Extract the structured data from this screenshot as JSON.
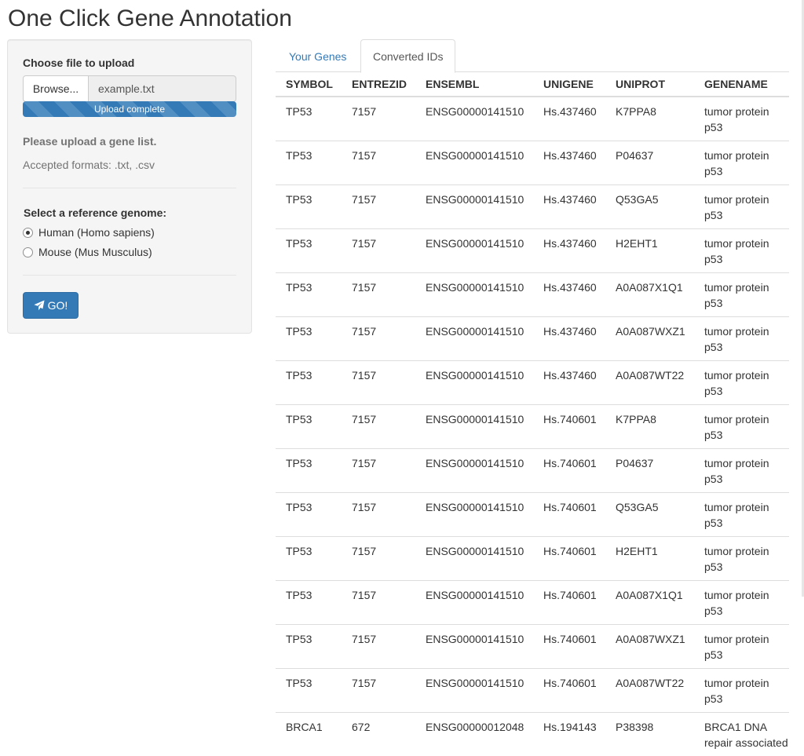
{
  "app": {
    "title": "One Click Gene Annotation"
  },
  "sidebar": {
    "upload_label": "Choose file to upload",
    "browse_label": "Browse...",
    "file_name": "example.txt",
    "progress_text": "Upload complete",
    "progress_value": 1.0,
    "help_title": "Please upload a gene list.",
    "help_formats": "Accepted formats: .txt, .csv",
    "genome_label": "Select a reference genome:",
    "genome_options": [
      {
        "label": "Human (Homo sapiens)",
        "checked": true
      },
      {
        "label": "Mouse (Mus Musculus)",
        "checked": false
      }
    ],
    "go_label": "GO!"
  },
  "tabs": [
    {
      "label": "Your Genes",
      "active": false
    },
    {
      "label": "Converted IDs",
      "active": true
    }
  ],
  "table": {
    "headers": [
      "SYMBOL",
      "ENTREZID",
      "ENSEMBL",
      "UNIGENE",
      "UNIPROT",
      "GENENAME"
    ],
    "rows": [
      [
        "TP53",
        "7157",
        "ENSG00000141510",
        "Hs.437460",
        "K7PPA8",
        "tumor protein p53"
      ],
      [
        "TP53",
        "7157",
        "ENSG00000141510",
        "Hs.437460",
        "P04637",
        "tumor protein p53"
      ],
      [
        "TP53",
        "7157",
        "ENSG00000141510",
        "Hs.437460",
        "Q53GA5",
        "tumor protein p53"
      ],
      [
        "TP53",
        "7157",
        "ENSG00000141510",
        "Hs.437460",
        "H2EHT1",
        "tumor protein p53"
      ],
      [
        "TP53",
        "7157",
        "ENSG00000141510",
        "Hs.437460",
        "A0A087X1Q1",
        "tumor protein p53"
      ],
      [
        "TP53",
        "7157",
        "ENSG00000141510",
        "Hs.437460",
        "A0A087WXZ1",
        "tumor protein p53"
      ],
      [
        "TP53",
        "7157",
        "ENSG00000141510",
        "Hs.437460",
        "A0A087WT22",
        "tumor protein p53"
      ],
      [
        "TP53",
        "7157",
        "ENSG00000141510",
        "Hs.740601",
        "K7PPA8",
        "tumor protein p53"
      ],
      [
        "TP53",
        "7157",
        "ENSG00000141510",
        "Hs.740601",
        "P04637",
        "tumor protein p53"
      ],
      [
        "TP53",
        "7157",
        "ENSG00000141510",
        "Hs.740601",
        "Q53GA5",
        "tumor protein p53"
      ],
      [
        "TP53",
        "7157",
        "ENSG00000141510",
        "Hs.740601",
        "H2EHT1",
        "tumor protein p53"
      ],
      [
        "TP53",
        "7157",
        "ENSG00000141510",
        "Hs.740601",
        "A0A087X1Q1",
        "tumor protein p53"
      ],
      [
        "TP53",
        "7157",
        "ENSG00000141510",
        "Hs.740601",
        "A0A087WXZ1",
        "tumor protein p53"
      ],
      [
        "TP53",
        "7157",
        "ENSG00000141510",
        "Hs.740601",
        "A0A087WT22",
        "tumor protein p53"
      ],
      [
        "BRCA1",
        "672",
        "ENSG00000012048",
        "Hs.194143",
        "P38398",
        "BRCA1 DNA repair associated"
      ]
    ]
  },
  "colors": {
    "primary": "#337ab7",
    "panel_bg": "#f5f5f5",
    "muted_text": "#737373",
    "border": "#dddddd"
  },
  "icons": {
    "go_button": "paper-plane-icon",
    "radio": "radio-dot-icon"
  }
}
